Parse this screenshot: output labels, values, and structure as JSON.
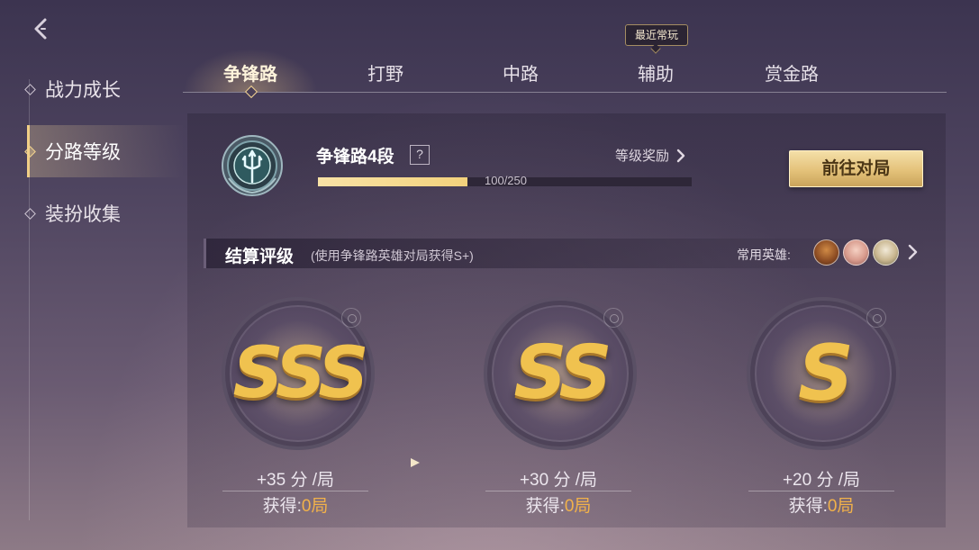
{
  "nav": {
    "back_icon": "chevron-left-icon"
  },
  "sidebar": {
    "items": [
      {
        "label": "战力成长",
        "active": false
      },
      {
        "label": "分路等级",
        "active": true
      },
      {
        "label": "装扮收集",
        "active": false
      }
    ]
  },
  "tabs": {
    "items": [
      {
        "label": "争锋路",
        "active": true
      },
      {
        "label": "打野",
        "active": false
      },
      {
        "label": "中路",
        "active": false
      },
      {
        "label": "辅助",
        "active": false
      },
      {
        "label": "赏金路",
        "active": false
      }
    ],
    "recent_badge": "最近常玩"
  },
  "rank": {
    "title": "争锋路4段",
    "help": "?",
    "reward_link": "等级奖励",
    "progress_text": "100/250",
    "progress_value": 100,
    "progress_max": 250,
    "emblem_icon": "trident-shield-icon"
  },
  "go_button": {
    "label": "前往对局"
  },
  "settlement": {
    "title": "结算评级",
    "subtitle": "(使用争锋路英雄对局获得S+)",
    "heroes_label": "常用英雄:"
  },
  "grades": [
    {
      "letters": "SSS",
      "score": "+35 分 /局",
      "earned_prefix": "获得:",
      "earned_value": "0局"
    },
    {
      "letters": "SS",
      "score": "+30 分 /局",
      "earned_prefix": "获得:",
      "earned_value": "0局"
    },
    {
      "letters": "S",
      "score": "+20 分 /局",
      "earned_prefix": "获得:",
      "earned_value": "0局"
    }
  ],
  "colors": {
    "accent_gold": "#f1cf86",
    "progress_fill": "#f3d27c",
    "earned_value": "#f2b24a",
    "grade_gold": "#f0c24f"
  }
}
